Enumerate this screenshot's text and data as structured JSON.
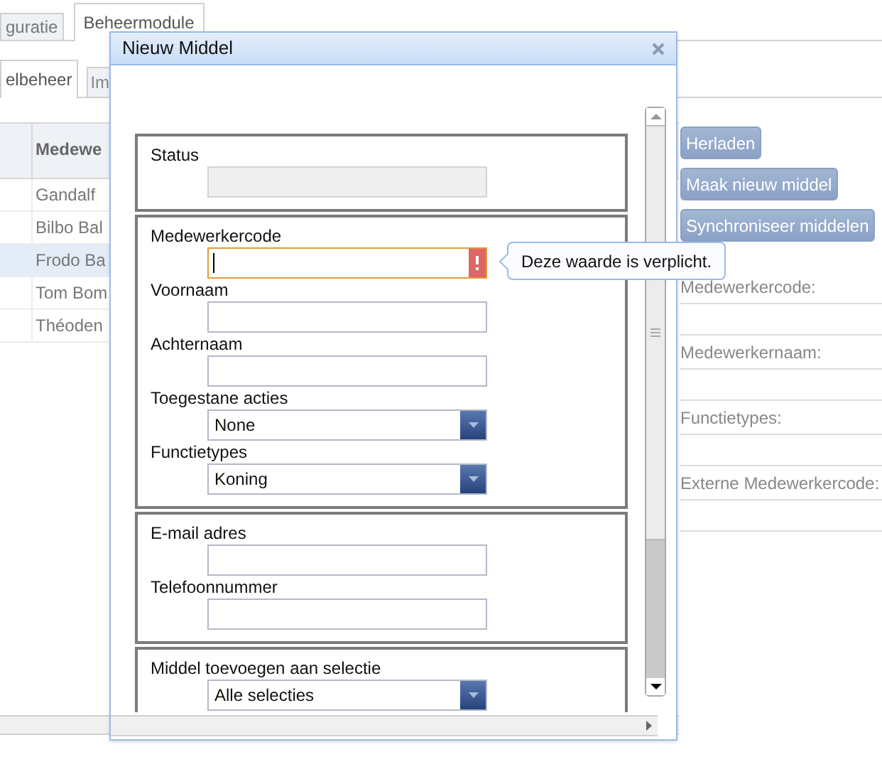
{
  "top_tabs": [
    {
      "label": "guratie",
      "selected": false
    },
    {
      "label": "Beheermodule",
      "selected": true
    }
  ],
  "sub_tabs": [
    {
      "label": "elbeheer",
      "selected": true
    },
    {
      "label": "Im",
      "selected": false
    }
  ],
  "grid": {
    "columns": [
      "Medewe"
    ],
    "rows": [
      {
        "cell": "Gandalf",
        "selected": false
      },
      {
        "cell": "Bilbo Bal",
        "selected": false
      },
      {
        "cell": "Frodo Ba",
        "selected": true
      },
      {
        "cell": "Tom Bom",
        "selected": false
      },
      {
        "cell": "Théoden",
        "selected": false
      }
    ]
  },
  "actions": [
    "Herladen",
    "Maak nieuw middel",
    "Synchroniseer middelen"
  ],
  "details": [
    "Medewerkercode:",
    "Medewerkernaam:",
    "Functietypes:",
    "Externe Medewerkercode:"
  ],
  "dialog": {
    "title": "Nieuw Middel",
    "sections": [
      {
        "fields": [
          {
            "label": "Status",
            "kind": "text",
            "disabled": true,
            "invalid": false,
            "focused": false
          }
        ]
      },
      {
        "fields": [
          {
            "label": "Medewerkercode",
            "kind": "text",
            "disabled": false,
            "invalid": true,
            "focused": true
          },
          {
            "label": "Voornaam",
            "kind": "text",
            "disabled": false,
            "invalid": false,
            "focused": false
          },
          {
            "label": "Achternaam",
            "kind": "text",
            "disabled": false,
            "invalid": false,
            "focused": false
          },
          {
            "label": "Toegestane acties",
            "kind": "select",
            "value": "None"
          },
          {
            "label": "Functietypes",
            "kind": "select",
            "value": "Koning"
          }
        ]
      },
      {
        "fields": [
          {
            "label": "E-mail adres",
            "kind": "text",
            "disabled": false,
            "invalid": false,
            "focused": false
          },
          {
            "label": "Telefoonnummer",
            "kind": "text",
            "disabled": false,
            "invalid": false,
            "focused": false
          }
        ]
      },
      {
        "fields": [
          {
            "label": "Middel toevoegen aan selectie",
            "kind": "select",
            "value": "Alle selecties"
          }
        ]
      }
    ],
    "error_tooltip": "Deze waarde is verplicht."
  }
}
